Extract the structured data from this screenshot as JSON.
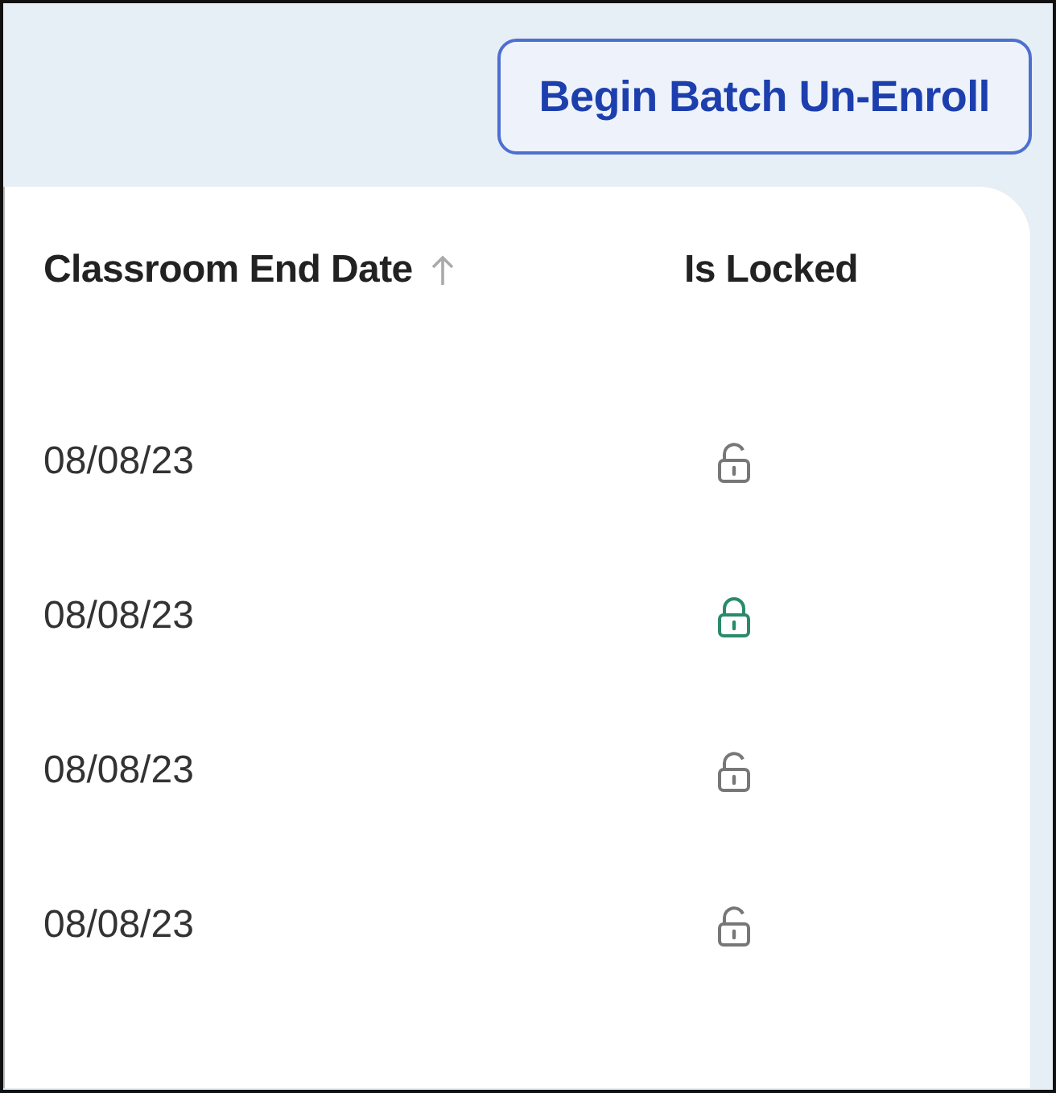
{
  "toolbar": {
    "button": "Begin Batch Un-Enroll"
  },
  "table": {
    "columns": [
      {
        "label": "Classroom End Date",
        "sorted": true
      },
      {
        "label": "Is Locked",
        "sorted": false
      }
    ],
    "rows": [
      {
        "end_date": "08/08/23",
        "locked": false
      },
      {
        "end_date": "08/08/23",
        "locked": true
      },
      {
        "end_date": "08/08/23",
        "locked": false
      },
      {
        "end_date": "08/08/23",
        "locked": false
      }
    ]
  }
}
